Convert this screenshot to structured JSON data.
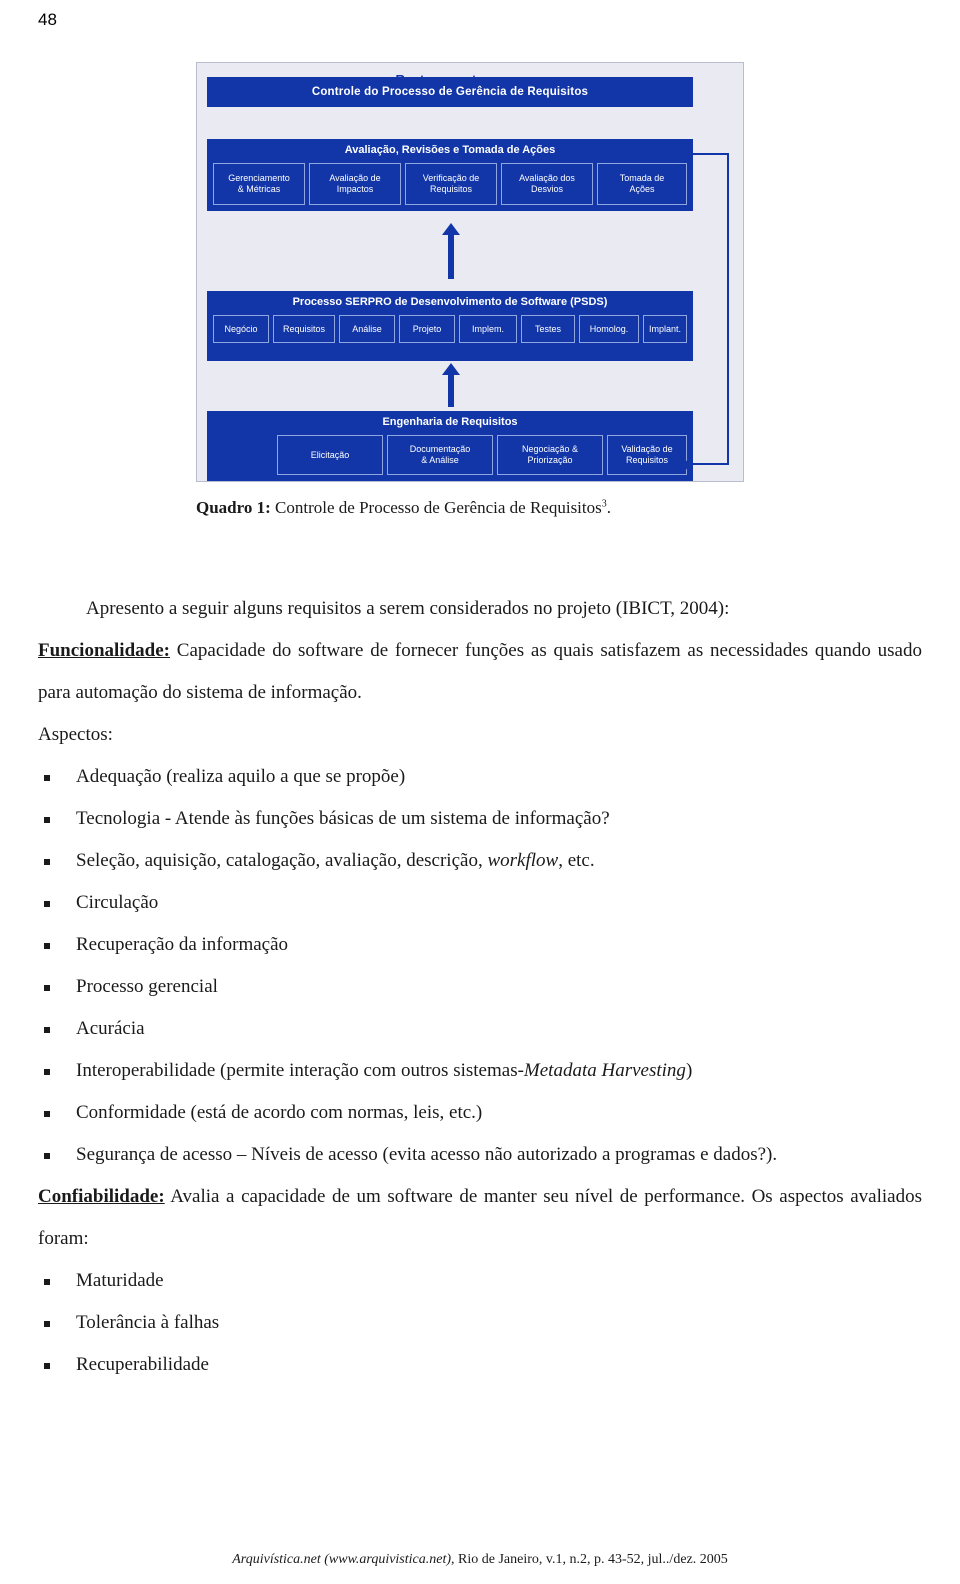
{
  "page": {
    "number": "48"
  },
  "figure": {
    "title_top": "Controle do Processo de Gerência de Requisitos",
    "rastreamento": "Rastreamento",
    "block_a": {
      "title": "Avaliação, Revisões e Tomada de Ações",
      "cells": [
        "Gerenciamento\n& Métricas",
        "Avaliação de\nImpactos",
        "Verificação de\nRequisitos",
        "Avaliação dos\nDesvios",
        "Tomada de\nAções"
      ]
    },
    "block_b": {
      "title": "Processo SERPRO de Desenvolvimento de Software (PSDS)",
      "cells": [
        "Negócio",
        "Requisitos",
        "Análise",
        "Projeto",
        "Implem.",
        "Testes",
        "Homolog.",
        "Implant."
      ]
    },
    "block_c": {
      "title": "Engenharia de Requisitos",
      "cells": [
        "Elicitação",
        "Documentação\n& Análise",
        "Negociação &\nPriorização",
        "Validação de\nRequisitos"
      ]
    }
  },
  "caption": {
    "label": "Quadro 1:",
    "text": " Controle de Processo de Gerência de Requisitos",
    "footnote_marker": "3",
    "end": "."
  },
  "content": {
    "intro": "Apresento a seguir alguns requisitos a serem considerados no projeto (IBICT, 2004):",
    "func_label": "Funcionalidade:",
    "func_text": " Capacidade do software de fornecer funções as quais satisfazem as necessidades quando usado para automação do sistema de informação.",
    "aspectos_label": "Aspectos:",
    "bullets": [
      {
        "parts": [
          {
            "t": "Adequação (realiza aquilo a que se propõe)",
            "style": "normal"
          }
        ]
      },
      {
        "parts": [
          {
            "t": "Tecnologia - Atende às funções básicas de um sistema de informação?",
            "style": "normal"
          }
        ]
      },
      {
        "parts": [
          {
            "t": "Seleção, aquisição, catalogação, avaliação, descrição, ",
            "style": "normal"
          },
          {
            "t": "workflow",
            "style": "italic"
          },
          {
            "t": ", etc.",
            "style": "normal"
          }
        ]
      },
      {
        "parts": [
          {
            "t": "Circulação",
            "style": "normal"
          }
        ]
      },
      {
        "parts": [
          {
            "t": "Recuperação da informação",
            "style": "normal"
          }
        ]
      },
      {
        "parts": [
          {
            "t": "Processo gerencial",
            "style": "normal"
          }
        ]
      },
      {
        "parts": [
          {
            "t": "Acurácia",
            "style": "normal"
          }
        ]
      },
      {
        "parts": [
          {
            "t": "Interoperabilidade (permite interação com outros sistemas-",
            "style": "normal"
          },
          {
            "t": "Metadata Harvesting",
            "style": "italic"
          },
          {
            "t": ")",
            "style": "normal"
          }
        ]
      },
      {
        "parts": [
          {
            "t": "Conformidade (está de acordo com normas, leis, etc.)",
            "style": "normal"
          }
        ]
      },
      {
        "parts": [
          {
            "t": "Segurança de acesso – Níveis de acesso (evita acesso não autorizado a programas e dados?).",
            "style": "normal",
            "justify": true
          }
        ]
      }
    ],
    "conf_label": "Confiabilidade:",
    "conf_text": " Avalia a capacidade de um software de manter seu nível de performance. Os aspectos avaliados foram:",
    "bullets2": [
      {
        "parts": [
          {
            "t": "Maturidade",
            "style": "normal"
          }
        ]
      },
      {
        "parts": [
          {
            "t": "Tolerância à falhas",
            "style": "normal"
          }
        ]
      },
      {
        "parts": [
          {
            "t": "Recuperabilidade",
            "style": "normal"
          }
        ]
      }
    ]
  },
  "footer": {
    "journal": "Arquivística.net (www.arquivistica.net)",
    "rest": ", Rio de Janeiro, v.1, n.2, p. 43-52, jul../dez. 2005"
  }
}
